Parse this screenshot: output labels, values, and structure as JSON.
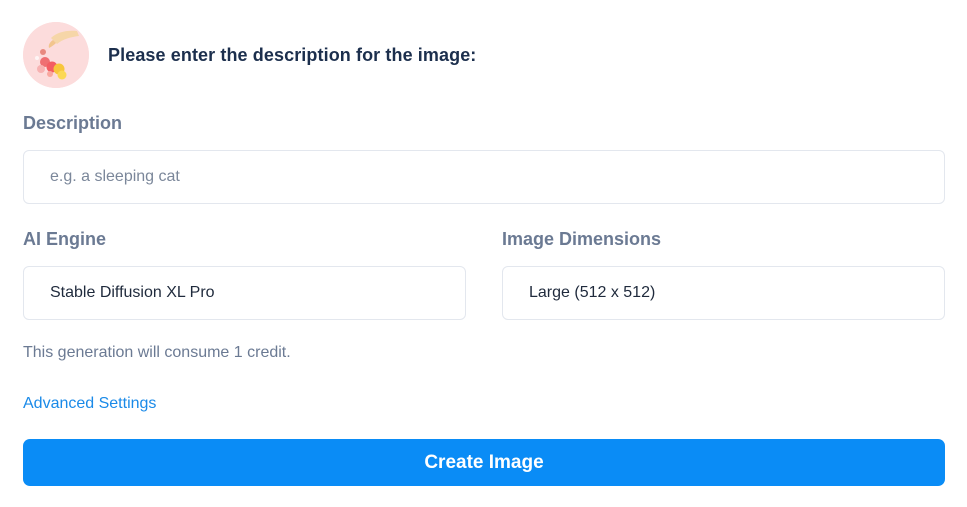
{
  "header": {
    "title": "Please enter the description for the image:",
    "avatar_icon": "candy-illustration-icon"
  },
  "description": {
    "label": "Description",
    "placeholder": "e.g. a sleeping cat",
    "value": ""
  },
  "engine": {
    "label": "AI Engine",
    "selected": "Stable Diffusion XL Pro"
  },
  "dimensions": {
    "label": "Image Dimensions",
    "selected": "Large (512 x 512)"
  },
  "credit_note": "This generation will consume 1 credit.",
  "advanced_link": "Advanced Settings",
  "create_button": "Create Image",
  "colors": {
    "accent": "#0a8cf6",
    "link": "#1a8ae8",
    "title": "#1c2f4d",
    "label": "#6b7a93",
    "avatar_bg": "#fcdcdc"
  }
}
